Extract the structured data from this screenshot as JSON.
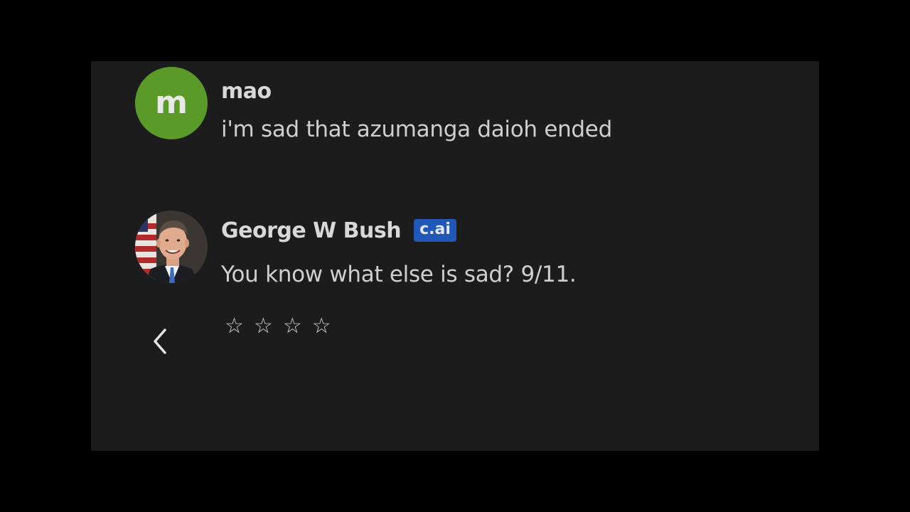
{
  "messages": [
    {
      "author": "mao",
      "avatar_letter": "m",
      "avatar_color": "#5a9a28",
      "text": "i'm sad that azumanga daioh ended"
    },
    {
      "author": "George W Bush",
      "badge": "c.ai",
      "badge_color": "#2158b8",
      "text": "You know what else is sad? 9/11."
    }
  ],
  "controls": {
    "back_icon": "chevron-left-icon",
    "rating": {
      "stars": [
        "☆",
        "☆",
        "☆",
        "☆"
      ],
      "value": 0,
      "max": 4
    }
  },
  "colors": {
    "page_background": "#000000",
    "panel_background": "#1c1c1c",
    "text": "#cfcfcf"
  }
}
